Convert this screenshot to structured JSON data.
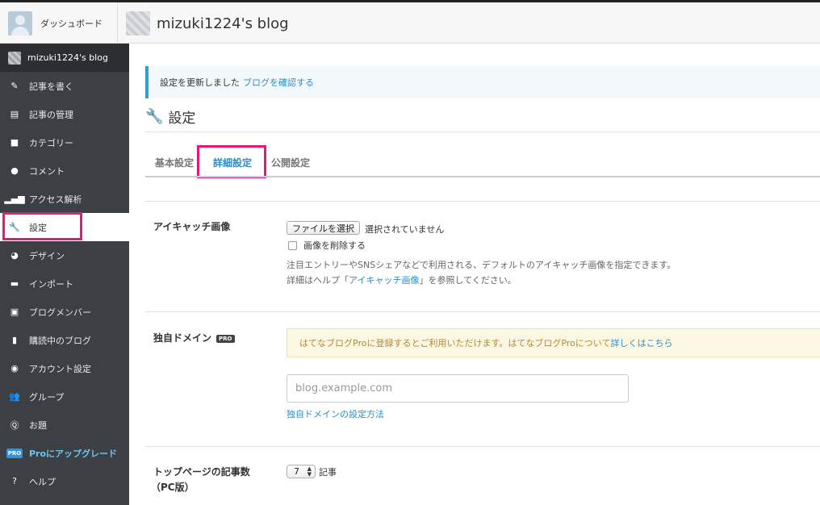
{
  "header": {
    "dashboard_label": "ダッシュボード",
    "blog_title": "mizuki1224's blog"
  },
  "sidebar": {
    "blog_label": "mizuki1224's blog",
    "items": [
      {
        "label": "記事を書く",
        "icon": "pencil-icon"
      },
      {
        "label": "記事の管理",
        "icon": "document-icon"
      },
      {
        "label": "カテゴリー",
        "icon": "folder-icon"
      },
      {
        "label": "コメント",
        "icon": "comment-icon"
      },
      {
        "label": "アクセス解析",
        "icon": "bar-chart-icon"
      },
      {
        "label": "設定",
        "icon": "wrench-icon",
        "active": true
      },
      {
        "label": "デザイン",
        "icon": "palette-icon"
      },
      {
        "label": "インポート",
        "icon": "truck-icon"
      },
      {
        "label": "ブログメンバー",
        "icon": "member-icon"
      },
      {
        "label": "購読中のブログ",
        "icon": "bookmark-icon"
      },
      {
        "label": "アカウント設定",
        "icon": "account-icon"
      },
      {
        "label": "グループ",
        "icon": "group-icon"
      },
      {
        "label": "お題",
        "icon": "topic-icon"
      },
      {
        "label": "Proにアップグレード",
        "icon": "pro-icon",
        "badge": "PRO"
      },
      {
        "label": "ヘルプ",
        "icon": "help-icon"
      }
    ]
  },
  "notice": {
    "text": "設定を更新しました",
    "link": "ブログを確認する"
  },
  "page": {
    "title": "設定"
  },
  "tabs": [
    {
      "label": "基本設定"
    },
    {
      "label": "詳細設定",
      "active": true
    },
    {
      "label": "公開設定"
    }
  ],
  "eyecatch": {
    "label": "アイキャッチ画像",
    "file_button": "ファイルを選択",
    "no_file": "選択されていません",
    "delete_label": "画像を削除する",
    "help_line1": "注目エントリーやSNSシェアなどで利用される、デフォルトのアイキャッチ画像を指定できます。",
    "help_line2_prefix": "詳細はヘルプ「",
    "help_line2_link": "アイキャッチ画像",
    "help_line2_suffix": "」を参照してください。"
  },
  "domain": {
    "label": "独自ドメイン",
    "badge": "PRO",
    "notice_text": "はてなブログProに登録するとご利用いただけます。はてなブログProについて",
    "notice_link": "詳しくはこちら",
    "placeholder": "blog.example.com",
    "setup_link": "独自ドメインの設定方法"
  },
  "article_count": {
    "label_line1": "トップページの記事数",
    "label_line2": "（PC版）",
    "value": "7",
    "unit": "記事"
  },
  "colors": {
    "sidebar_bg": "#3c3f44",
    "accent": "#2e8dc8",
    "highlight": "#e8187a"
  }
}
